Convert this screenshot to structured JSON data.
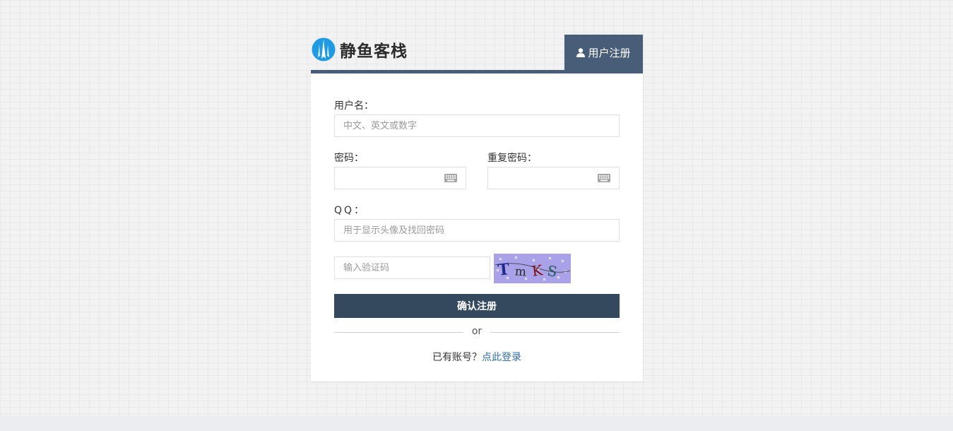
{
  "brand": {
    "logo_text": "静鱼客栈",
    "logo_icon": "jingyu-logo-icon"
  },
  "tab": {
    "label": "用户注册",
    "icon": "user-icon"
  },
  "form": {
    "username": {
      "label": "用户名：",
      "placeholder": "中文、英文或数字",
      "value": ""
    },
    "password": {
      "label": "密码：",
      "value": "",
      "icon": "keyboard-icon"
    },
    "repeat_password": {
      "label": "重复密码：",
      "value": "",
      "icon": "keyboard-icon"
    },
    "qq": {
      "label": "QQ：",
      "placeholder": "用于显示头像及找回密码",
      "value": ""
    },
    "captcha": {
      "placeholder": "输入验证码",
      "value": "",
      "image_text": "TmKS"
    },
    "submit_label": "确认注册"
  },
  "divider_text": "or",
  "login_prompt": {
    "text": "已有账号？",
    "link": "点此登录"
  },
  "colors": {
    "accent": "#485e78",
    "button": "#34495e",
    "link": "#2f6ea8",
    "logo_blue": "#1e9be4"
  }
}
